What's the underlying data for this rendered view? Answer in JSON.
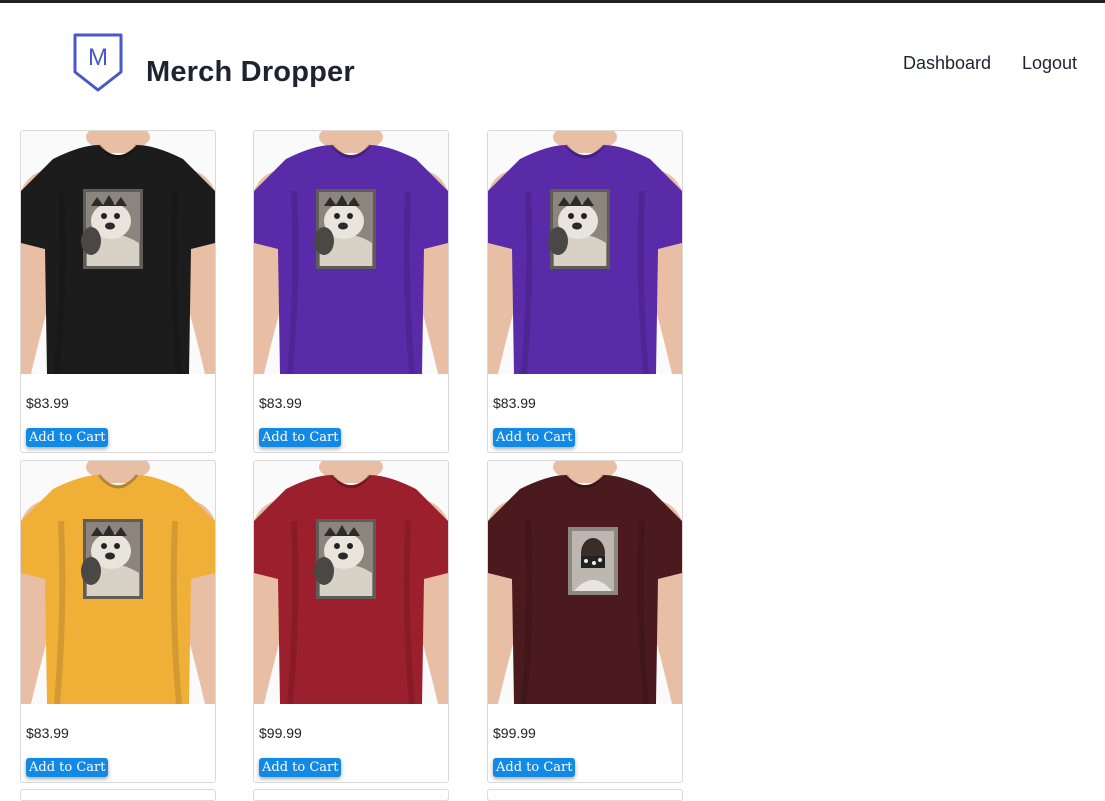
{
  "app": {
    "brand": "Merch Dropper",
    "logo_letter": "M",
    "accent": "#4a57c9"
  },
  "nav": {
    "dashboard": "Dashboard",
    "logout": "Logout"
  },
  "products": [
    {
      "price": "$83.99",
      "button": "Add to Cart",
      "shirt_color": "#1c1c1c",
      "design": "dog"
    },
    {
      "price": "$83.99",
      "button": "Add to Cart",
      "shirt_color": "#5a2ba8",
      "design": "dog"
    },
    {
      "price": "$83.99",
      "button": "Add to Cart",
      "shirt_color": "#5a2ba8",
      "design": "dog"
    },
    {
      "price": "$83.99",
      "button": "Add to Cart",
      "shirt_color": "#f0b038",
      "design": "dog"
    },
    {
      "price": "$99.99",
      "button": "Add to Cart",
      "shirt_color": "#9c1f2e",
      "design": "dog"
    },
    {
      "price": "$99.99",
      "button": "Add to Cart",
      "shirt_color": "#4a1a1f",
      "design": "person"
    }
  ],
  "colors": {
    "button": "#1289e5",
    "card_border": "#d9d9d9",
    "skin": "#e8bfa4"
  }
}
